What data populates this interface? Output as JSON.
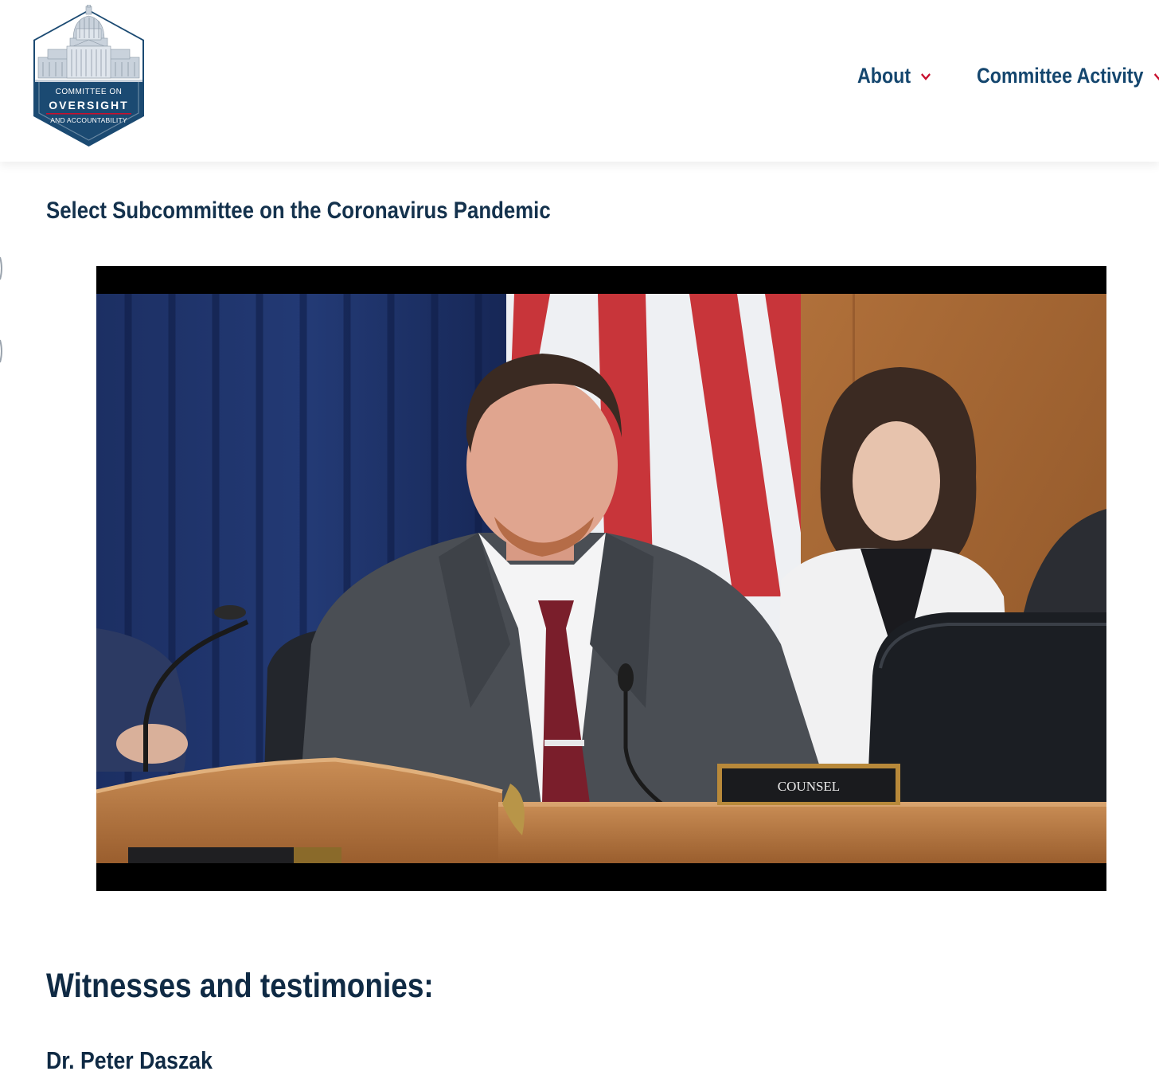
{
  "logo": {
    "line1": "COMMITTEE ON",
    "line2": "OVERSIGHT",
    "line3": "AND ACCOUNTABILITY",
    "colors": {
      "hex": "#1b4a72",
      "accent": "#c8102e"
    }
  },
  "nav": {
    "items": [
      {
        "label": "About",
        "icon": "chevron-down-icon"
      },
      {
        "label": "Committee Activity",
        "icon": "chevron-down-icon"
      }
    ],
    "text_color": "#14466e",
    "chevron_color": "#c8102e"
  },
  "page": {
    "subtitle": "Select Subcommittee on the Coronavirus Pandemic",
    "section_heading": "Witnesses and testimonies:",
    "witnesses": [
      "Dr. Peter Daszak"
    ]
  },
  "video": {
    "nameplate": "COUNSEL"
  }
}
